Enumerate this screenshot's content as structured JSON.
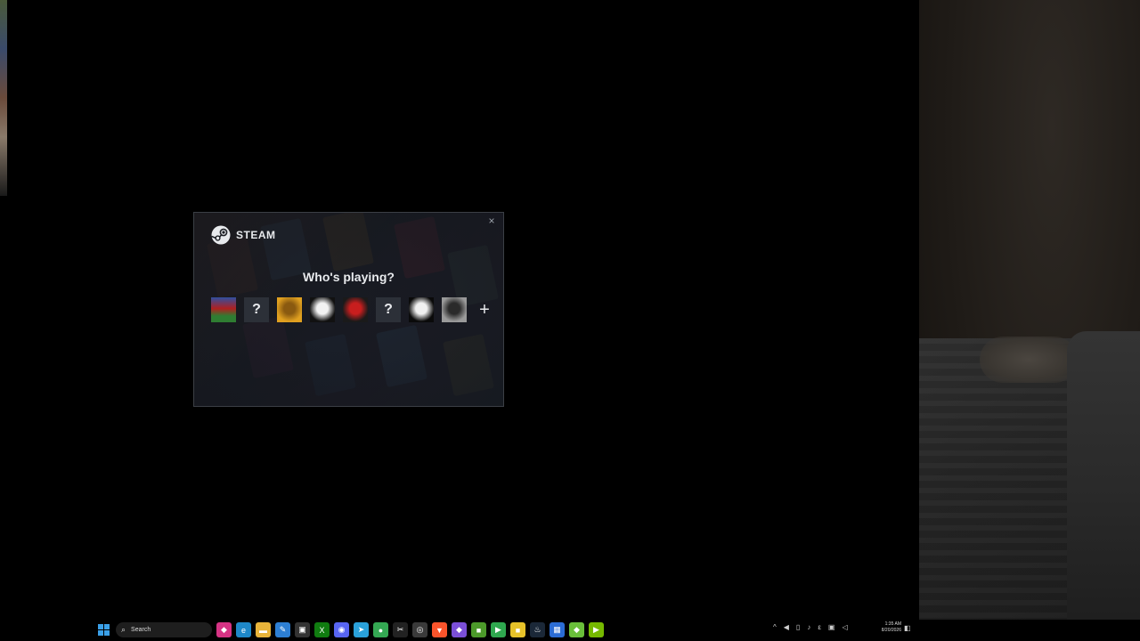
{
  "dialog": {
    "brand": "STEAM",
    "title": "Who's playing?",
    "close_glyph": "×",
    "avatars": [
      {
        "kind": "image",
        "name": "green-character-avatar",
        "colors": [
          "#2f7d32",
          "#b02020",
          "#3050a0"
        ]
      },
      {
        "kind": "unknown",
        "glyph": "?"
      },
      {
        "kind": "image",
        "name": "gold-character-avatar",
        "colors": [
          "#e0a020",
          "#8a5a10"
        ]
      },
      {
        "kind": "image",
        "name": "white-hand-avatar",
        "colors": [
          "#111111",
          "#f2f2f2"
        ]
      },
      {
        "kind": "image",
        "name": "red-cap-character-avatar",
        "colors": [
          "#1a1a1a",
          "#c81e1e"
        ]
      },
      {
        "kind": "unknown",
        "glyph": "?"
      },
      {
        "kind": "image",
        "name": "black-white-hand-avatar",
        "colors": [
          "#0a0a0a",
          "#f0f0f0"
        ]
      },
      {
        "kind": "image",
        "name": "gray-figure-avatar",
        "colors": [
          "#9a9a9a",
          "#2a2a2a"
        ]
      }
    ],
    "add_glyph": "+"
  },
  "taskbar": {
    "search_placeholder": "Search",
    "apps": [
      {
        "name": "app-pink-icon",
        "color": "#d63384",
        "glyph": "◆"
      },
      {
        "name": "edge-icon",
        "color": "#1e88c8",
        "glyph": "e"
      },
      {
        "name": "file-explorer-icon",
        "color": "#e8b43a",
        "glyph": "▬"
      },
      {
        "name": "notepad-icon",
        "color": "#2d7fd3",
        "glyph": "✎"
      },
      {
        "name": "terminal-icon",
        "color": "#333333",
        "glyph": "▣"
      },
      {
        "name": "xbox-icon",
        "color": "#107c10",
        "glyph": "X"
      },
      {
        "name": "discord-icon",
        "color": "#5865f2",
        "glyph": "◉"
      },
      {
        "name": "telegram-icon",
        "color": "#2aa1da",
        "glyph": "➤"
      },
      {
        "name": "chrome-icon",
        "color": "#34a853",
        "glyph": "●"
      },
      {
        "name": "capcut-icon",
        "color": "#222222",
        "glyph": "✂"
      },
      {
        "name": "obs-icon",
        "color": "#3a3a3a",
        "glyph": "◎"
      },
      {
        "name": "brave-icon",
        "color": "#fb542b",
        "glyph": "▼"
      },
      {
        "name": "app-purple-icon",
        "color": "#7b4fd8",
        "glyph": "◆"
      },
      {
        "name": "minecraft-icon",
        "color": "#4c9a2a",
        "glyph": "■"
      },
      {
        "name": "app-green-icon",
        "color": "#2fa84f",
        "glyph": "▶"
      },
      {
        "name": "app-yellow-icon",
        "color": "#e6c229",
        "glyph": "■"
      },
      {
        "name": "steam-icon",
        "color": "#1b2838",
        "glyph": "♨"
      },
      {
        "name": "app-blue-icon",
        "color": "#2b6cd4",
        "glyph": "▦"
      },
      {
        "name": "app-lime-icon",
        "color": "#6abf3a",
        "glyph": "◆"
      },
      {
        "name": "app-nvidia-icon",
        "color": "#76b900",
        "glyph": "▶"
      }
    ],
    "tray": [
      "^",
      "◀",
      "▯",
      "♪",
      "ε",
      "▣",
      "◁"
    ],
    "clock_time": "1:35 AM",
    "clock_date": "8/20/2026"
  }
}
